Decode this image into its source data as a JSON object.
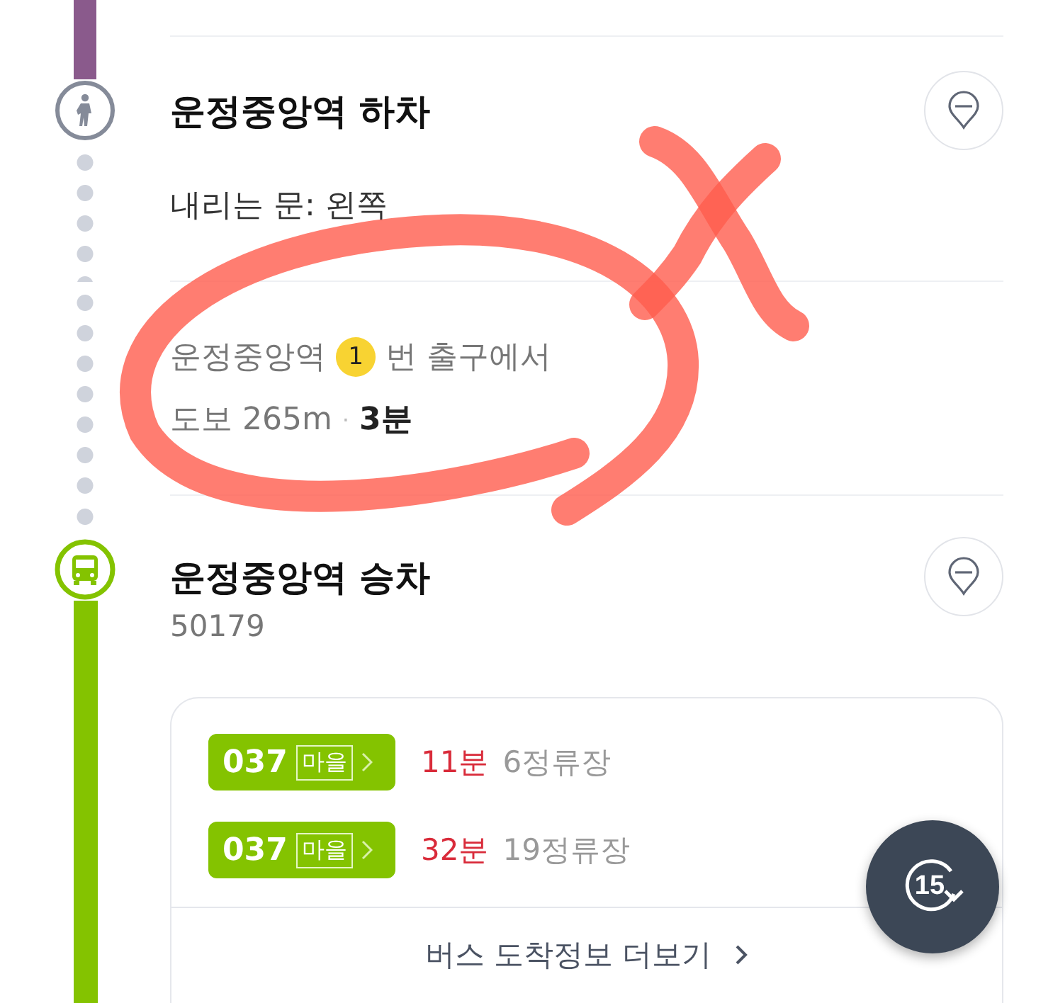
{
  "alight": {
    "kind": "walk",
    "title": "운정중앙역 하차",
    "door": "내리는 문: 왼쪽"
  },
  "exit": {
    "station": "운정중앙역",
    "exit_number": "1",
    "suffix": "번 출구에서",
    "walk": "도보 265m",
    "separator": "·",
    "time": "3분"
  },
  "board": {
    "kind": "bus",
    "title": "운정중앙역 승차",
    "stop_number": "50179",
    "arrivals": [
      {
        "route": "037",
        "type": "마을",
        "time": "11분",
        "stops": "6정류장"
      },
      {
        "route": "037",
        "type": "마을",
        "time": "32분",
        "stops": "19정류장"
      }
    ],
    "more": "버스 도착정보 더보기"
  },
  "refresh": {
    "seconds": "15"
  }
}
